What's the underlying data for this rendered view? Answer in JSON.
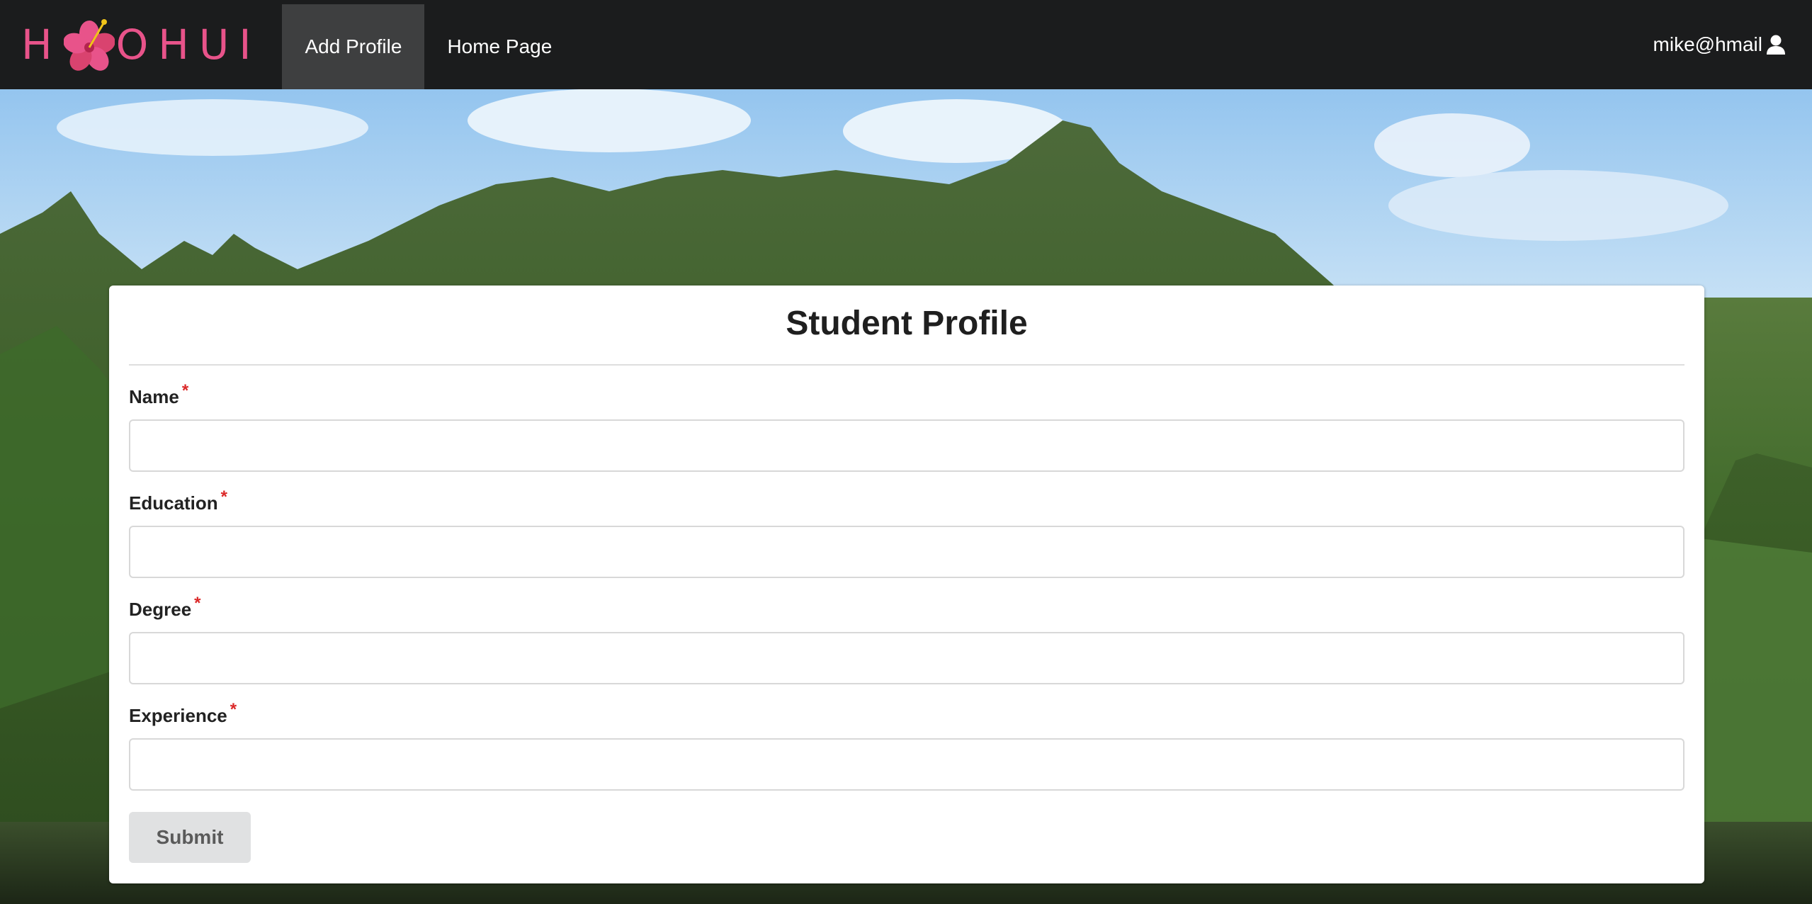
{
  "navbar": {
    "brand": {
      "letters": [
        "H",
        "O",
        "H",
        "U",
        "I"
      ],
      "logo_icon": "hibiscus-flower-icon"
    },
    "items": [
      {
        "label": "Add Profile",
        "active": true
      },
      {
        "label": "Home Page",
        "active": false
      }
    ],
    "user": {
      "email": "mike@hmail",
      "icon": "user-icon"
    }
  },
  "form": {
    "title": "Student Profile",
    "fields": [
      {
        "label": "Name",
        "required_marker": "*",
        "value": ""
      },
      {
        "label": "Education",
        "required_marker": "*",
        "value": ""
      },
      {
        "label": "Degree",
        "required_marker": "*",
        "value": ""
      },
      {
        "label": "Experience",
        "required_marker": "*",
        "value": ""
      }
    ],
    "submit_label": "Submit"
  },
  "colors": {
    "navbar_bg": "#1b1c1d",
    "navbar_active_bg": "#3e3f40",
    "brand_pink": "#e8538a",
    "required_red": "#db2828",
    "button_bg": "#e0e1e2"
  }
}
